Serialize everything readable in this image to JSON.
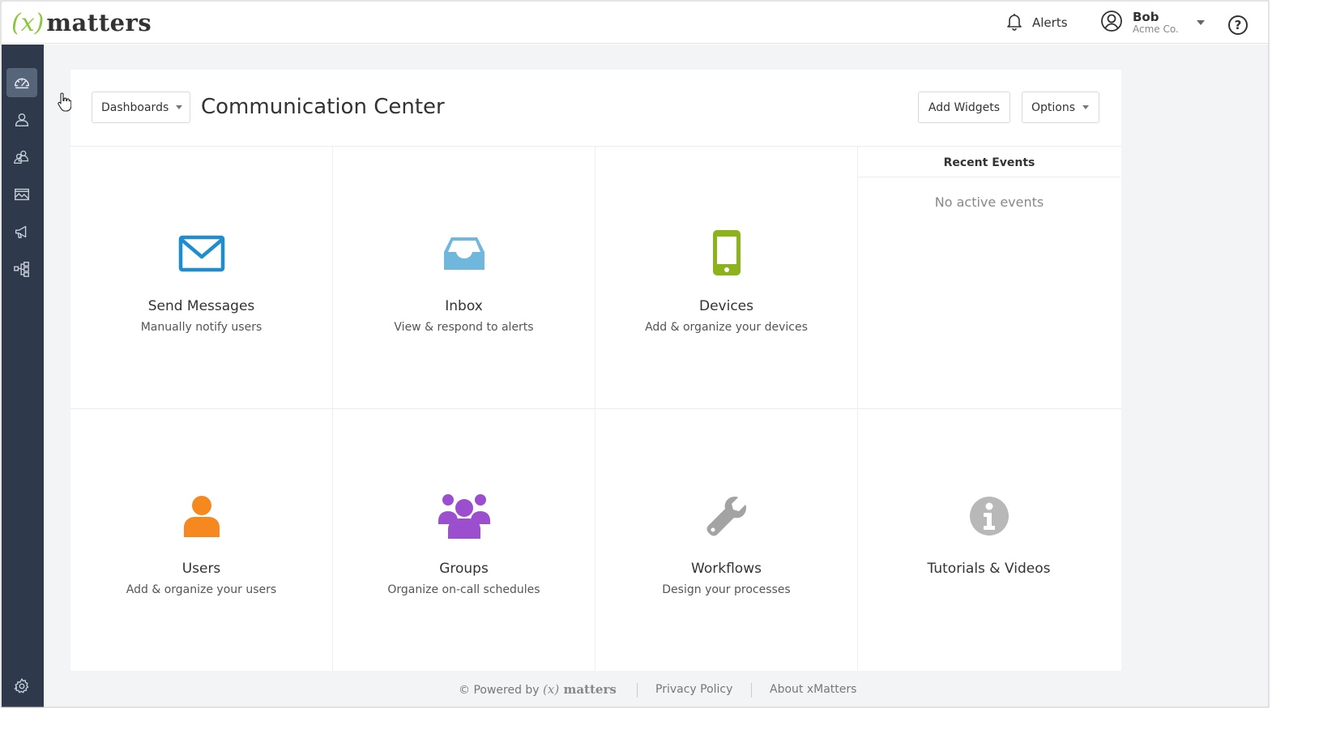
{
  "brand": {
    "paren": "(x)",
    "word": "matters"
  },
  "header": {
    "alerts_label": "Alerts",
    "user_name": "Bob",
    "user_org": "Acme Co.",
    "help_glyph": "?"
  },
  "sidebar": {
    "items": [
      {
        "icon": "dashboard-gauge-icon",
        "active": true
      },
      {
        "icon": "user-icon",
        "active": false
      },
      {
        "icon": "groups-icon",
        "active": false
      },
      {
        "icon": "reports-image-icon",
        "active": false
      },
      {
        "icon": "megaphone-icon",
        "active": false
      },
      {
        "icon": "workflow-hierarchy-icon",
        "active": false
      }
    ],
    "bottom_icon": "gear-icon",
    "expand_glyph": "»"
  },
  "toolbar": {
    "dashboards_label": "Dashboards",
    "page_title": "Communication Center",
    "add_widgets_label": "Add Widgets",
    "options_label": "Options"
  },
  "widgets": [
    {
      "icon": "envelope-icon",
      "color": "#1f8ed0",
      "title": "Send Messages",
      "subtitle": "Manually notify users"
    },
    {
      "icon": "inbox-tray-icon",
      "color": "#6fb7dd",
      "title": "Inbox",
      "subtitle": "View & respond to alerts"
    },
    {
      "icon": "mobile-phone-icon",
      "color": "#8cb21c",
      "title": "Devices",
      "subtitle": "Add & organize your devices"
    },
    {
      "icon": "single-user-icon",
      "color": "#f5891f",
      "title": "Users",
      "subtitle": "Add & organize your users"
    },
    {
      "icon": "group-people-icon",
      "color": "#9b4fcf",
      "title": "Groups",
      "subtitle": "Organize on-call schedules"
    },
    {
      "icon": "wrench-icon",
      "color": "#9a9a9a",
      "title": "Workflows",
      "subtitle": "Design your processes"
    },
    {
      "icon": "info-circle-icon",
      "color": "#b5b5b5",
      "title": "Tutorials & Videos",
      "subtitle": ""
    }
  ],
  "recent_events": {
    "heading": "Recent Events",
    "empty_text": "No active events"
  },
  "footer": {
    "powered_by": "© Powered by",
    "logo_paren": "(x)",
    "logo_word": "matters",
    "privacy_label": "Privacy Policy",
    "about_label": "About xMatters"
  },
  "colors": {
    "sidebar_bg": "#2e3a4c",
    "brand_green": "#8dc63f"
  }
}
